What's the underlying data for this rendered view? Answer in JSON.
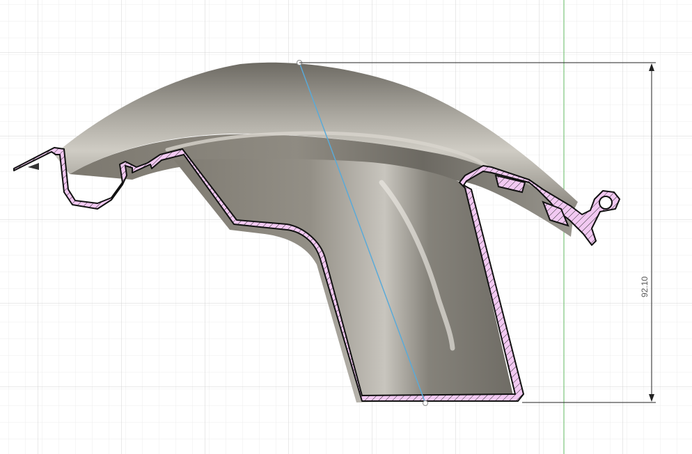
{
  "viewport": {
    "grid_on": true,
    "background_color": "#ffffff",
    "grid_minor_color": "#eeeeee",
    "grid_major_color": "#d6d6d6",
    "axis_green_color": "#6fc36f"
  },
  "part": {
    "body_color": "#8a877f",
    "section_fill_color": "#f2c9f2",
    "section_outline_color": "#111111",
    "measure_line_color": "#5aaad8"
  },
  "dimension": {
    "value": "92.10",
    "line_color": "#222222"
  }
}
